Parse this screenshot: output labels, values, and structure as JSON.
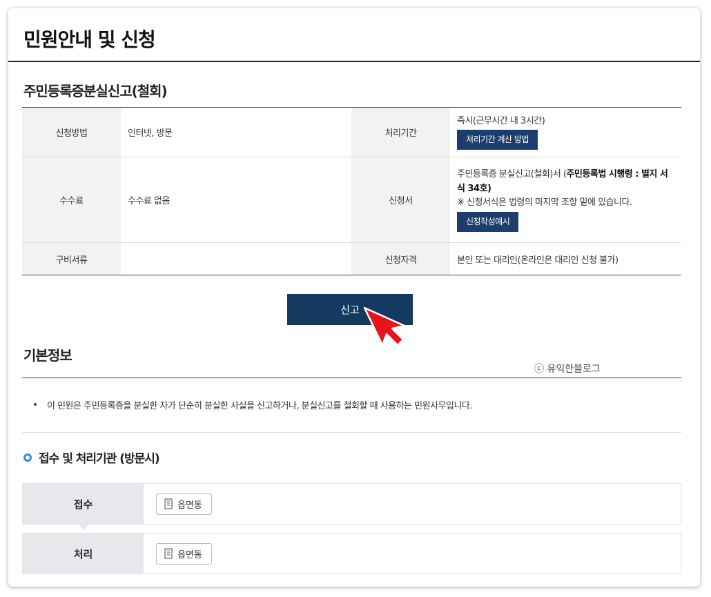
{
  "page_title": "민원안내 및 신청",
  "service_title": "주민등록증분실신고(철회)",
  "info_table": {
    "method_label": "신청방법",
    "method_value": "인터넷, 방문",
    "period_label": "처리기간",
    "period_value": "즉시(근무시간 내 3시간)",
    "period_button": "처리기간 계산 방법",
    "fee_label": "수수료",
    "fee_value": "수수료 없음",
    "form_label": "신청서",
    "form_value_plain": "주민등록증 분실신고(철회)서 (",
    "form_value_bold": "주민등록법 시행령 : 별지 서식 34호",
    "form_value_close": ")",
    "form_note": "※ 신청서식은 법령의 마지막 조항 밑에 있습니다.",
    "form_button": "신청작성예시",
    "docs_label": "구비서류",
    "docs_value": "",
    "eligibility_label": "신청자격",
    "eligibility_value": "본인 또는 대리인(온라인은 대리인 신청 불가)"
  },
  "report_button": "신고",
  "basic_info": {
    "title": "기본정보",
    "watermark": "ⓒ 유익한블로그",
    "description": "이 민원은 주민등록증을 분실한 자가 단순히 분실한 사실을 신고하거나, 분실신고를 철회할 때 사용하는 민원사무입니다."
  },
  "agency": {
    "title": "접수 및 처리기관 (방문시)",
    "rows": [
      {
        "label": "접수",
        "office": "읍면동"
      },
      {
        "label": "처리",
        "office": "읍면동"
      }
    ]
  },
  "colors": {
    "navy": "#153a60",
    "button_navy": "#1d3d6e",
    "ring_blue": "#2a8de8",
    "arrow_red": "#e8141b"
  }
}
